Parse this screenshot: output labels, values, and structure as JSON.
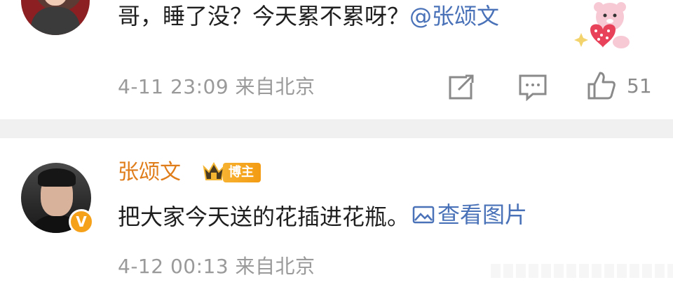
{
  "comments": [
    {
      "text": "哥，睡了没？今天累不累呀？",
      "mention": "@张颂文",
      "date": "4-11 23:09",
      "location": "来自北京",
      "likes": "51",
      "avatar_icon": "user-avatar",
      "sticker_icon": "pink-bear-heart-sticker"
    },
    {
      "username": "张颂文",
      "badge": "博主",
      "text": "把大家今天送的花插进花瓶。",
      "view_picture": "查看图片",
      "date": "4-12 00:13",
      "location": "来自北京",
      "verified_mark": "V"
    }
  ],
  "icons": {
    "repost": "share-icon",
    "reply": "comment-icon",
    "like": "thumbs-up-icon",
    "picture": "image-icon",
    "crown": "crown-icon"
  },
  "colors": {
    "mention": "#4a72b8",
    "username": "#e07d1b",
    "badge": "#f39b13",
    "meta": "#9a9a9a",
    "divider": "#f0f0f0"
  }
}
